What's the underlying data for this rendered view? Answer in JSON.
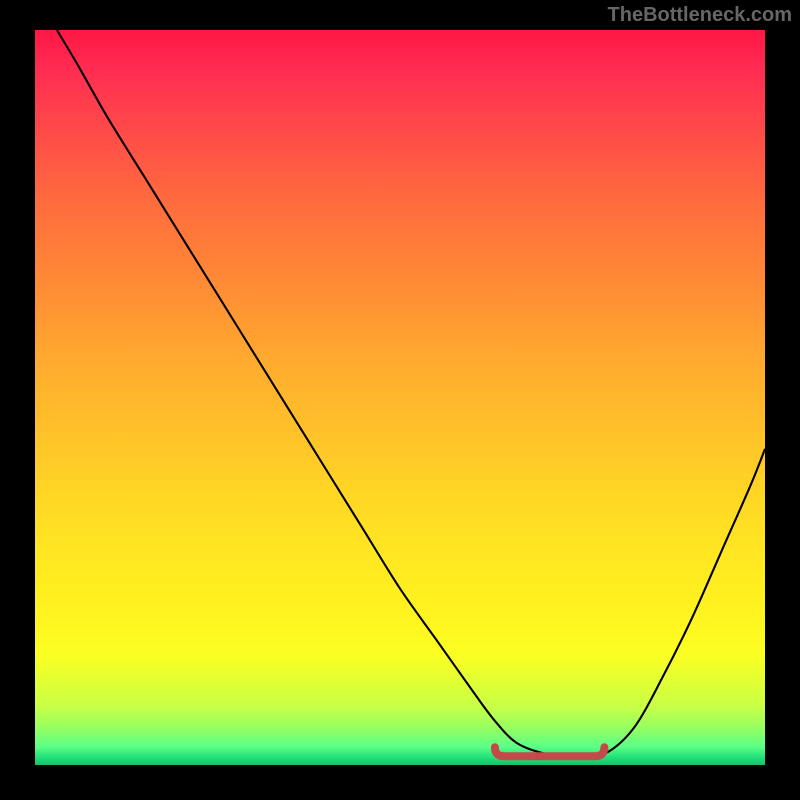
{
  "watermark": "TheBottleneck.com",
  "chart_data": {
    "type": "line",
    "title": "",
    "xlabel": "",
    "ylabel": "",
    "xlim": [
      0,
      100
    ],
    "ylim": [
      0,
      100
    ],
    "curve": {
      "x": [
        3,
        6,
        10,
        15,
        20,
        25,
        30,
        35,
        40,
        45,
        50,
        55,
        60,
        63,
        66,
        70,
        74,
        78,
        82,
        86,
        90,
        94,
        98,
        100
      ],
      "y": [
        100,
        95,
        88,
        80,
        72,
        64,
        56,
        48,
        40,
        32,
        24,
        17,
        10,
        6,
        3,
        1.5,
        1,
        1.5,
        5,
        12,
        20,
        29,
        38,
        43
      ]
    },
    "valley_marker": {
      "x_start": 63,
      "x_end": 78,
      "y": 1.2
    },
    "background_gradient": {
      "top": "#ff1744",
      "mid": "#ffd824",
      "bottom": "#18c06a"
    }
  }
}
